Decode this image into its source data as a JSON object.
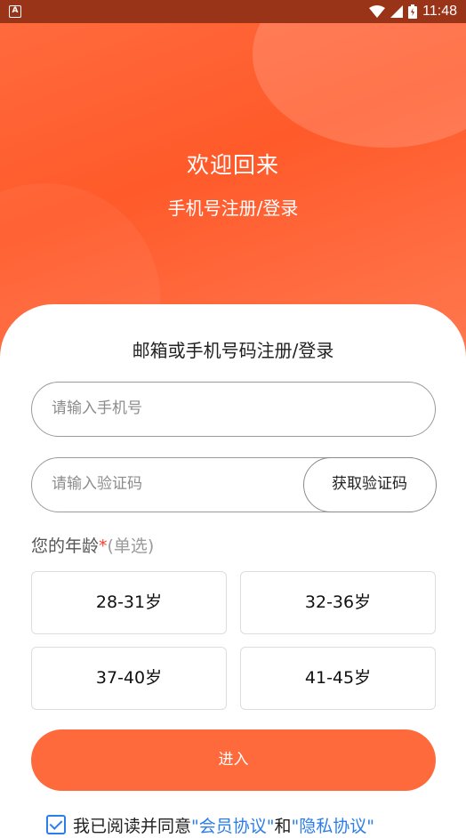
{
  "status_bar": {
    "time": "11:48",
    "left_icon": "A"
  },
  "hero": {
    "title": "欢迎回来",
    "subtitle": "手机号注册/登录"
  },
  "form": {
    "title": "邮箱或手机号码注册/登录",
    "phone_placeholder": "请输入手机号",
    "code_placeholder": "请输入验证码",
    "get_code_label": "获取验证码",
    "age_label": "您的年龄",
    "age_required_mark": "*",
    "age_hint": "(单选)",
    "age_options": [
      "28-31岁",
      "32-36岁",
      "37-40岁",
      "41-45岁"
    ],
    "submit_label": "进入"
  },
  "agreement": {
    "prefix": "我已阅读并同意",
    "member_link": "\"会员协议\"",
    "conjunction": "和",
    "privacy_link": "\"隐私协议\"",
    "checked": true
  },
  "colors": {
    "accent": "#ff6a3d",
    "link": "#2b7de9",
    "status_bar": "#9a3418"
  }
}
